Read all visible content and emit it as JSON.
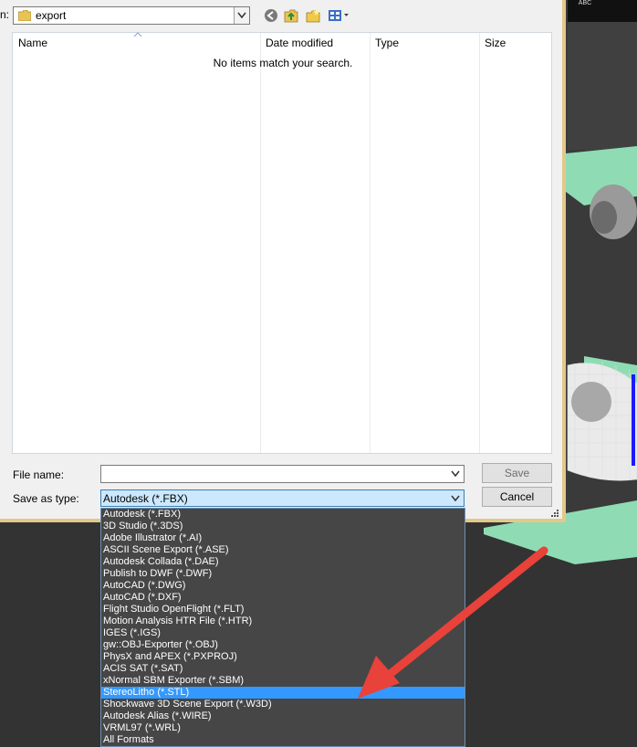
{
  "dialog": {
    "location_label": "n:",
    "location_value": "export",
    "file_name_label": "File name:",
    "file_name_value": "",
    "save_as_type_label": "Save as type:",
    "save_as_type_value": "Autodesk (*.FBX)",
    "save_label": "Save",
    "cancel_label": "Cancel"
  },
  "file_list": {
    "columns": [
      "Name",
      "Date modified",
      "Type",
      "Size"
    ],
    "empty_message": "No items match your search."
  },
  "type_options": [
    "Autodesk (*.FBX)",
    "3D Studio (*.3DS)",
    "Adobe Illustrator (*.AI)",
    "ASCII Scene Export (*.ASE)",
    "Autodesk Collada (*.DAE)",
    "Publish to DWF (*.DWF)",
    "AutoCAD (*.DWG)",
    "AutoCAD (*.DXF)",
    "Flight Studio OpenFlight (*.FLT)",
    "Motion Analysis HTR File (*.HTR)",
    "IGES (*.IGS)",
    "gw::OBJ-Exporter (*.OBJ)",
    "PhysX and APEX (*.PXPROJ)",
    "ACIS SAT (*.SAT)",
    "xNormal SBM Exporter (*.SBM)",
    "StereoLitho (*.STL)",
    "Shockwave 3D Scene Export (*.W3D)",
    "Autodesk Alias (*.WIRE)",
    "VRML97 (*.WRL)",
    "All Formats"
  ],
  "selected_option": "StereoLitho (*.STL)",
  "viewport": {
    "abc_label": "ABC"
  },
  "colors": {
    "highlight": "#3399ff",
    "arrow": "#e8423a",
    "list_bg": "#464646",
    "mesh_green": "#8fdcb4"
  }
}
